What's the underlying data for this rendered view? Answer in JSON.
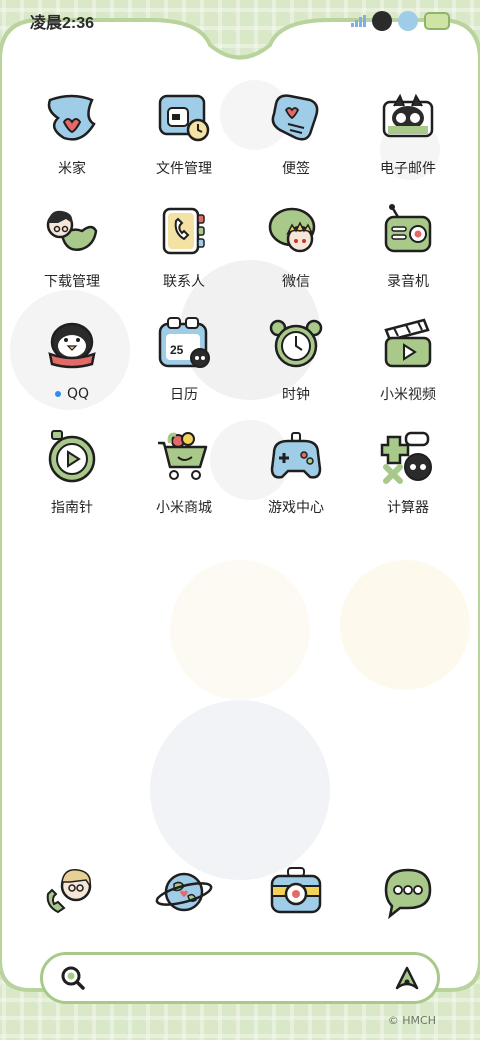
{
  "status_bar": {
    "time": "凌晨2:36"
  },
  "apps": [
    {
      "label": "米家",
      "icon": "mijia-icon"
    },
    {
      "label": "文件管理",
      "icon": "file-manager-icon"
    },
    {
      "label": "便签",
      "icon": "notes-icon"
    },
    {
      "label": "电子邮件",
      "icon": "email-icon"
    },
    {
      "label": "下载管理",
      "icon": "download-manager-icon"
    },
    {
      "label": "联系人",
      "icon": "contacts-icon"
    },
    {
      "label": "微信",
      "icon": "wechat-icon"
    },
    {
      "label": "录音机",
      "icon": "recorder-icon"
    },
    {
      "label": "QQ",
      "icon": "qq-penguin-icon"
    },
    {
      "label": "日历",
      "icon": "calendar-icon"
    },
    {
      "label": "时钟",
      "icon": "alarm-clock-icon"
    },
    {
      "label": "小米视频",
      "icon": "video-clapper-icon"
    },
    {
      "label": "指南针",
      "icon": "compass-icon"
    },
    {
      "label": "小米商城",
      "icon": "shopping-cart-icon"
    },
    {
      "label": "游戏中心",
      "icon": "gamepad-icon"
    },
    {
      "label": "计算器",
      "icon": "calculator-icon"
    }
  ],
  "calendar_day": "25",
  "dock": [
    {
      "icon": "phone-icon"
    },
    {
      "icon": "browser-planet-icon"
    },
    {
      "icon": "camera-icon"
    },
    {
      "icon": "messages-icon"
    }
  ],
  "search": {
    "left_icon": "search-icon",
    "right_icon": "xiaoai-assistant-icon"
  },
  "copyright": "© HMCH",
  "colors": {
    "accent_green": "#a8c98a",
    "outline": "#1f1f1f",
    "blue": "#9fcde8",
    "red": "#e46a6a",
    "notify_dot": "#2d8cf0"
  }
}
